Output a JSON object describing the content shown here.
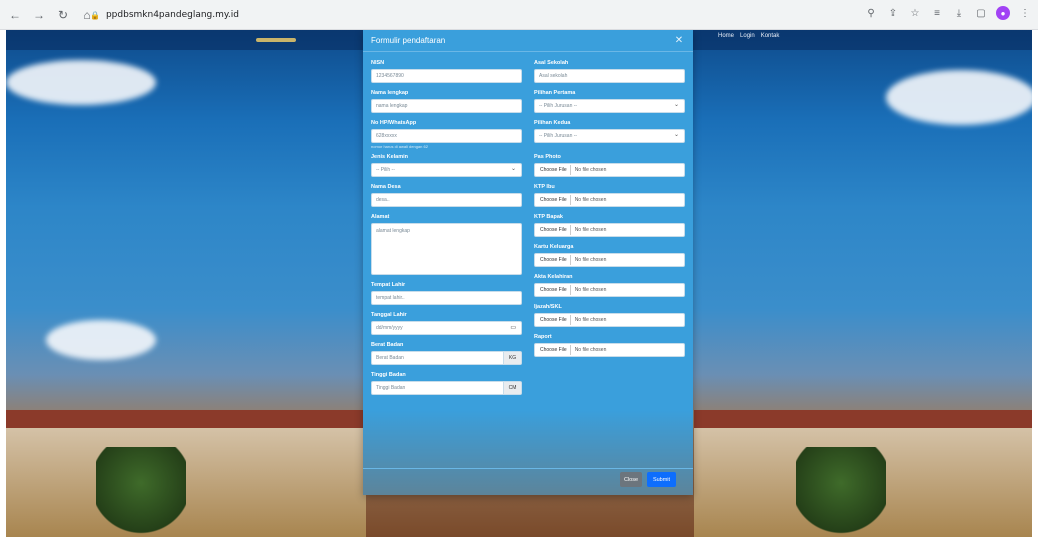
{
  "browser": {
    "url": "ppdbsmkn4pandeglang.my.id",
    "icons": [
      "back-icon",
      "forward-icon",
      "reload-icon",
      "home-icon"
    ]
  },
  "site_nav": {
    "items": [
      "Home",
      "Login",
      "Kontak"
    ]
  },
  "modal": {
    "title": "Formulir pendaftaran",
    "close_button": "Close",
    "submit_button": "Submit",
    "left": {
      "nisn": {
        "label": "NISN",
        "value": "1234567890"
      },
      "nama": {
        "label": "Nama lengkap",
        "placeholder": "nama lengkap"
      },
      "hp": {
        "label": "No HP/WhatsApp",
        "placeholder": "628xxxxx",
        "help": "nomor harus di awali dengan 62"
      },
      "jk": {
        "label": "Jenis Kelamin",
        "selected": "-- Pilih --"
      },
      "desa": {
        "label": "Nama Desa",
        "placeholder": "desa.."
      },
      "alamat": {
        "label": "Alamat",
        "placeholder": "alamat lengkap"
      },
      "tempat_lahir": {
        "label": "Tempat Lahir",
        "placeholder": "tempat lahir.."
      },
      "tanggal_lahir": {
        "label": "Tanggal Lahir",
        "placeholder": "dd/mm/yyyy"
      },
      "berat": {
        "label": "Berat Badan",
        "placeholder": "Berat Badan",
        "unit": "KG"
      },
      "tinggi": {
        "label": "Tinggi Badan",
        "placeholder": "Tinggi Badan",
        "unit": "CM"
      }
    },
    "right": {
      "asal_sekolah": {
        "label": "Asal Sekolah",
        "placeholder": "Asal sekolah"
      },
      "pilihan1": {
        "label": "Pilihan Pertama",
        "selected": "-- Pilih Jurusan --"
      },
      "pilihan2": {
        "label": "Pilihan Kedua",
        "selected": "-- Pilih Jurusan --"
      },
      "choose_file": "Choose File",
      "no_file": "No file chosen",
      "files": [
        "Pas Photo",
        "KTP Ibu",
        "KTP Bapak",
        "Kartu Keluarga",
        "Akta Kelahiran",
        "Ijazah/SKL",
        "Raport"
      ]
    }
  }
}
